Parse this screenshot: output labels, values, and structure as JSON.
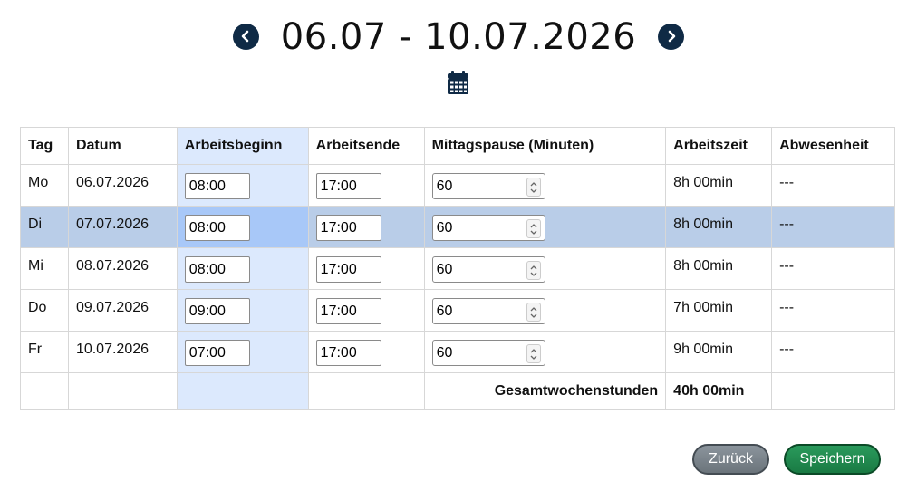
{
  "header": {
    "week_range": "06.07 - 10.07.2026",
    "prev_icon": "chevron-left-icon",
    "next_icon": "chevron-right-icon",
    "calendar_icon": "calendar-icon"
  },
  "table": {
    "columns": [
      "Tag",
      "Datum",
      "Arbeitsbeginn",
      "Arbeitsende",
      "Mittagspause (Minuten)",
      "Arbeitszeit",
      "Abwesenheit"
    ],
    "rows": [
      {
        "tag": "Mo",
        "datum": "06.07.2026",
        "beginn": "08:00",
        "ende": "17:00",
        "pause": "60",
        "arbeitszeit": "8h 00min",
        "abwesenheit": "---"
      },
      {
        "tag": "Di",
        "datum": "07.07.2026",
        "beginn": "08:00",
        "ende": "17:00",
        "pause": "60",
        "arbeitszeit": "8h 00min",
        "abwesenheit": "---"
      },
      {
        "tag": "Mi",
        "datum": "08.07.2026",
        "beginn": "08:00",
        "ende": "17:00",
        "pause": "60",
        "arbeitszeit": "8h 00min",
        "abwesenheit": "---"
      },
      {
        "tag": "Do",
        "datum": "09.07.2026",
        "beginn": "09:00",
        "ende": "17:00",
        "pause": "60",
        "arbeitszeit": "7h 00min",
        "abwesenheit": "---"
      },
      {
        "tag": "Fr",
        "datum": "10.07.2026",
        "beginn": "07:00",
        "ende": "17:00",
        "pause": "60",
        "arbeitszeit": "9h 00min",
        "abwesenheit": "---"
      }
    ],
    "total_label": "Gesamtwochenstunden",
    "total_value": "40h 00min"
  },
  "buttons": {
    "back_label": "Zurück",
    "save_label": "Speichern"
  },
  "colors": {
    "nav": "#0f2a45",
    "selected_row": "#b9cde8",
    "begin_column": "#dce9fd",
    "back_button": "#747d84",
    "save_button": "#1f8a4e"
  }
}
